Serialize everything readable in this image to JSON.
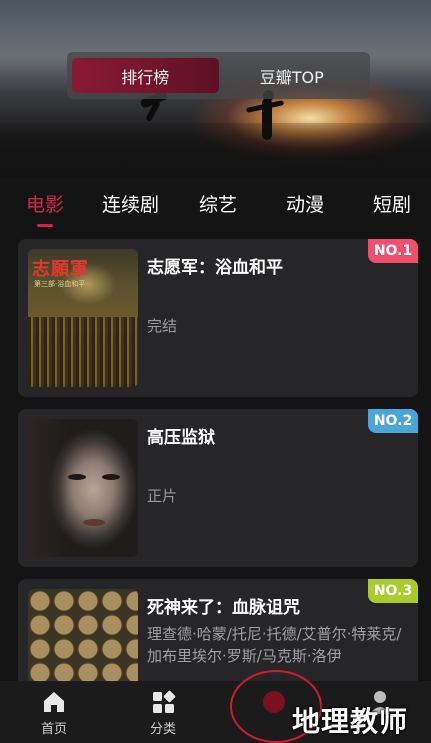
{
  "header": {
    "segments": [
      {
        "label": "排行榜",
        "active": true
      },
      {
        "label": "豆瓣TOP",
        "active": false
      }
    ]
  },
  "tabs": [
    {
      "label": "电影",
      "active": true
    },
    {
      "label": "连续剧",
      "active": false
    },
    {
      "label": "综艺",
      "active": false
    },
    {
      "label": "动漫",
      "active": false
    },
    {
      "label": "短剧",
      "active": false
    }
  ],
  "list": [
    {
      "rank": "NO.1",
      "rank_color": "#f0506e",
      "title": "志愿军：浴血和平",
      "status": "完结",
      "poster_text": "志願軍",
      "poster_subtext": "第三部·浴血和平"
    },
    {
      "rank": "NO.2",
      "rank_color": "#4aa6d8",
      "title": "高压监狱",
      "status": "正片"
    },
    {
      "rank": "NO.3",
      "rank_color": "#a8cc2a",
      "title": "死神来了：血脉诅咒",
      "description": "理查德·哈蒙/托尼·托德/艾普尔·特莱克/加布里埃尔·罗斯/马克斯·洛伊"
    }
  ],
  "bottom_nav": [
    {
      "label": "首页",
      "icon": "home-icon"
    },
    {
      "label": "分类",
      "icon": "category-icon"
    },
    {
      "label": "",
      "icon": "discover-icon"
    },
    {
      "label": "",
      "icon": "profile-icon"
    }
  ],
  "watermark": {
    "text": "地理教师"
  },
  "colors": {
    "accent": "#d4224b",
    "background": "#141414",
    "card": "#262628"
  }
}
